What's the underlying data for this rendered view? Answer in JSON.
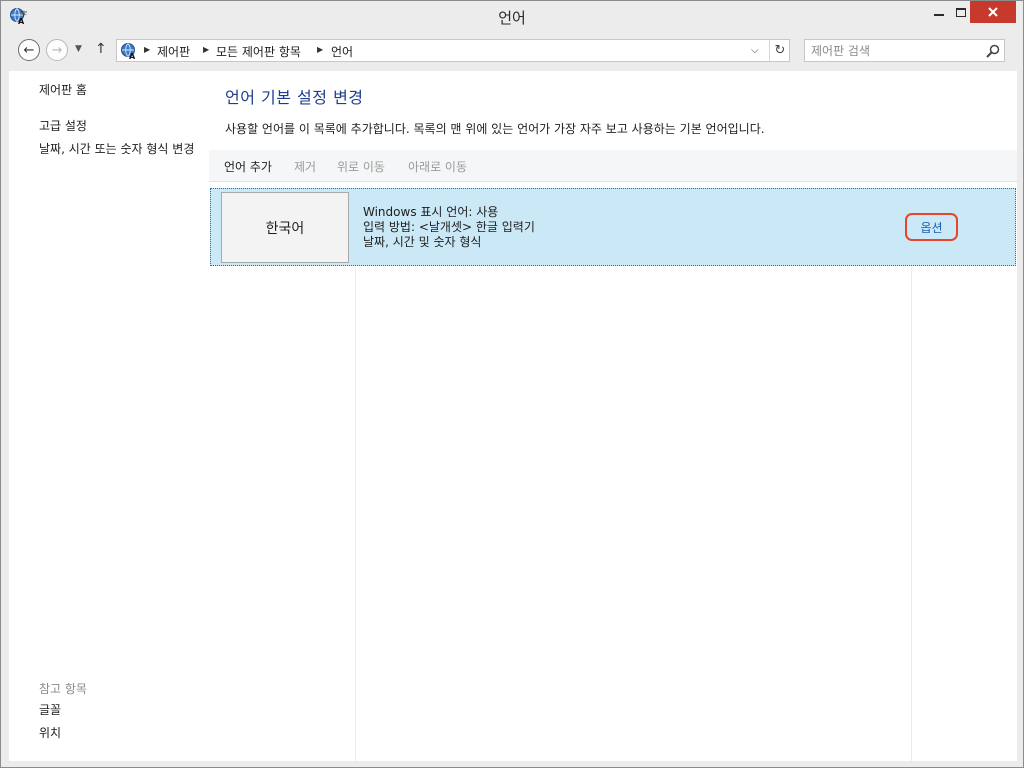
{
  "window": {
    "title": "언어"
  },
  "nav": {
    "breadcrumb": [
      "제어판",
      "모든 제어판 항목",
      "언어"
    ],
    "search_placeholder": "제어판 검색"
  },
  "sidebar": {
    "home": "제어판 홈",
    "advanced": "고급 설정",
    "datetime": "날짜, 시간 또는 숫자 형식 변경",
    "see_also_header": "참고 항목",
    "see_also": [
      "글꼴",
      "위치"
    ]
  },
  "main": {
    "title": "언어 기본 설정 변경",
    "description": "사용할 언어를 이 목록에 추가합니다. 목록의 맨 위에 있는 언어가 가장 자주 보고 사용하는 기본 언어입니다.",
    "toolbar": {
      "add": "언어 추가",
      "remove": "제거",
      "move_up": "위로 이동",
      "move_down": "아래로 이동"
    },
    "languages": [
      {
        "name": "한국어",
        "details": [
          "Windows 표시 언어: 사용",
          "입력 방법: <날개셋> 한글 입력기",
          "날짜, 시간 및 숫자 형식"
        ],
        "options_label": "옵션"
      }
    ]
  },
  "colors": {
    "accent_title": "#1f3d8f",
    "selection_bg": "#cbe8f6",
    "link_blue": "#1a5fb4",
    "close_red": "#c7392c",
    "highlight_red": "#e8442a"
  }
}
